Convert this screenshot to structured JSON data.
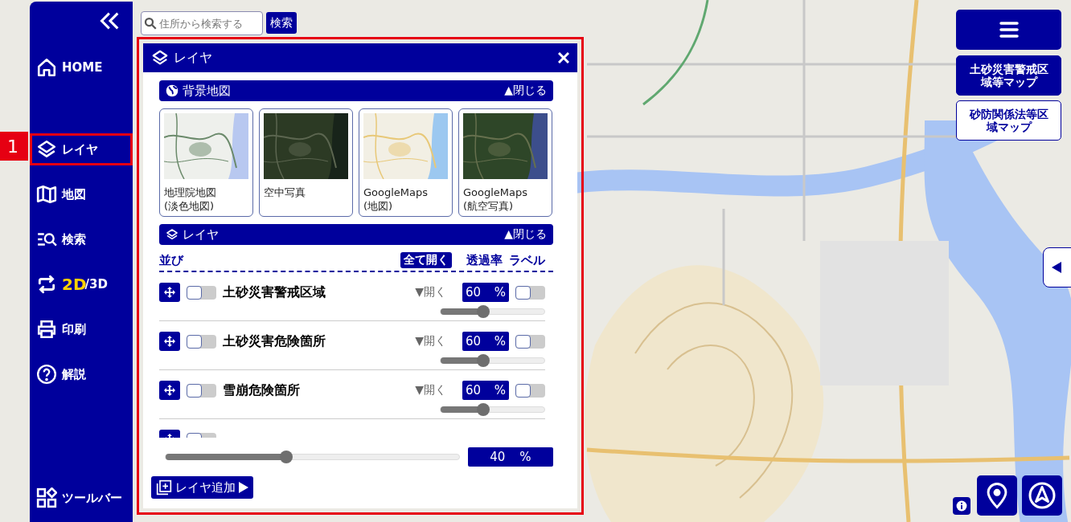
{
  "sidebar": {
    "items": [
      {
        "kind": "link",
        "label": "HOME",
        "selected": false
      },
      {
        "kind": "link",
        "label": "レイヤ",
        "selected": true,
        "callout": "1"
      },
      {
        "kind": "link",
        "label": "地図",
        "selected": false
      },
      {
        "kind": "link",
        "label": "検索",
        "selected": false
      },
      {
        "kind": "mode",
        "active_part": "2D",
        "other_part": "/3D",
        "selected": false
      },
      {
        "kind": "link",
        "label": "印刷",
        "selected": false
      },
      {
        "kind": "link",
        "label": "解説",
        "selected": false
      },
      {
        "kind": "bottom",
        "label": "ツールバー",
        "selected": false
      }
    ]
  },
  "search": {
    "placeholder": "住所から検索する",
    "button": "検索"
  },
  "panel": {
    "title": "レイヤ",
    "basemap": {
      "title": "背景地図",
      "toggle": "▲閉じる",
      "options": [
        {
          "lines": [
            "地理院地図",
            "(淡色地図)"
          ]
        },
        {
          "lines": [
            "空中写真"
          ]
        },
        {
          "lines": [
            "GoogleMaps",
            "(地図)"
          ]
        },
        {
          "lines": [
            "GoogleMaps",
            "(航空写真)"
          ]
        }
      ]
    },
    "layers": {
      "title": "レイヤ",
      "toggle": "▲閉じる",
      "order": "並び",
      "expand_all": "全て開く",
      "opacity": "透過率",
      "label": "ラベル",
      "items": [
        {
          "name": "土砂災害警戒区域",
          "visible": false,
          "expand": "▼開く",
          "opacity": "60",
          "unit": "%",
          "level": 0.41,
          "label_on": false
        },
        {
          "name": "土砂災害危険箇所",
          "visible": false,
          "expand": "▼開く",
          "opacity": "60",
          "unit": "%",
          "level": 0.41,
          "label_on": false
        },
        {
          "name": "雪崩危険箇所",
          "visible": false,
          "expand": "▼開く",
          "opacity": "60",
          "unit": "%",
          "level": 0.41,
          "label_on": false
        },
        {
          "visible": false
        }
      ]
    },
    "overall": {
      "level": 0.41,
      "opacity": "40",
      "unit": "%"
    },
    "add_button": "レイヤ追加"
  },
  "map_buttons": [
    {
      "lines": [
        "土砂災害警戒区",
        "域等マップ"
      ],
      "selected": true
    },
    {
      "lines": [
        "砂防関係法等区",
        "域マップ"
      ],
      "selected": false
    }
  ]
}
